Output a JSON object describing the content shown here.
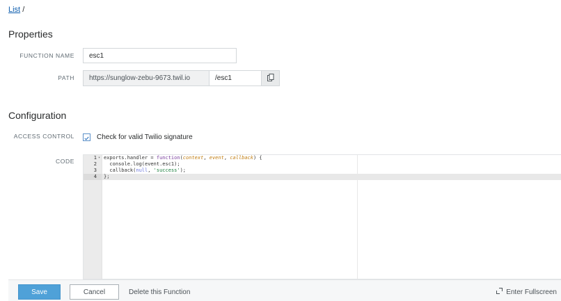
{
  "breadcrumb": {
    "list_link": "List",
    "separator": "/"
  },
  "properties": {
    "title": "Properties",
    "function_name_label": "FUNCTION NAME",
    "function_name_value": "esc1",
    "path_label": "PATH",
    "path_prefix": "https://sunglow-zebu-9673.twil.io",
    "path_value": "/esc1",
    "copy_icon": "copy-icon"
  },
  "configuration": {
    "title": "Configuration",
    "access_control_label": "ACCESS CONTROL",
    "access_control_checked": true,
    "access_control_text": "Check for valid Twilio signature",
    "code_label": "CODE"
  },
  "editor": {
    "line_numbers": [
      "1",
      "2",
      "3",
      "4"
    ],
    "active_line": 4,
    "lines": [
      [
        {
          "t": "exports.handler = ",
          "c": "plain"
        },
        {
          "t": "function",
          "c": "kw"
        },
        {
          "t": "(",
          "c": "plain"
        },
        {
          "t": "context",
          "c": "param"
        },
        {
          "t": ", ",
          "c": "plain"
        },
        {
          "t": "event",
          "c": "param"
        },
        {
          "t": ", ",
          "c": "plain"
        },
        {
          "t": "callback",
          "c": "param"
        },
        {
          "t": ") {",
          "c": "plain"
        }
      ],
      [
        {
          "t": "  console.log(event.esc1);",
          "c": "plain"
        }
      ],
      [
        {
          "t": "  callback(",
          "c": "plain"
        },
        {
          "t": "null",
          "c": "null"
        },
        {
          "t": ", ",
          "c": "plain"
        },
        {
          "t": "'success'",
          "c": "str"
        },
        {
          "t": ");",
          "c": "plain"
        }
      ],
      [
        {
          "t": "};",
          "c": "plain"
        }
      ]
    ]
  },
  "footer": {
    "save_label": "Save",
    "cancel_label": "Cancel",
    "delete_label": "Delete this Function",
    "fullscreen_label": "Enter Fullscreen"
  },
  "colors": {
    "primary_button": "#4fa1d8",
    "link": "#0b5cad"
  }
}
